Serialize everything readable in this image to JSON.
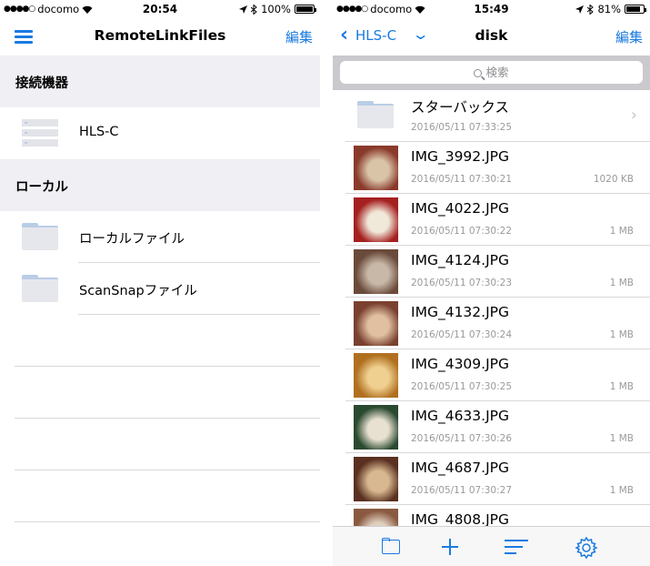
{
  "colors": {
    "accent": "#1a7ae0",
    "section_bg": "#efeff4",
    "secondary_text": "#9a9a9f"
  },
  "left": {
    "status": {
      "carrier": "docomo",
      "time": "20:54",
      "battery": "100%",
      "battery_level": 1.0
    },
    "nav": {
      "title": "RemoteLinkFiles",
      "edit_label": "編集",
      "menu_icon": "hamburger-menu-icon"
    },
    "sections": [
      {
        "title": "接続機器",
        "items": [
          {
            "label": "HLS-C",
            "icon": "server-icon"
          }
        ]
      },
      {
        "title": "ローカル",
        "items": [
          {
            "label": "ローカルファイル",
            "icon": "folder-icon"
          },
          {
            "label": "ScanSnapファイル",
            "icon": "folder-icon"
          }
        ]
      }
    ]
  },
  "right": {
    "status": {
      "carrier": "docomo",
      "time": "15:49",
      "battery": "81%",
      "battery_level": 0.81
    },
    "nav": {
      "back_label": "HLS-C",
      "title": "disk",
      "edit_label": "編集"
    },
    "search": {
      "placeholder": "検索"
    },
    "files": [
      {
        "name": "スターバックス",
        "date": "2016/05/11 07:33:25",
        "size": "",
        "type": "folder"
      },
      {
        "name": "IMG_3992.JPG",
        "date": "2016/05/11 07:30:21",
        "size": "1020 KB",
        "type": "image"
      },
      {
        "name": "IMG_4022.JPG",
        "date": "2016/05/11 07:30:22",
        "size": "1 MB",
        "type": "image"
      },
      {
        "name": "IMG_4124.JPG",
        "date": "2016/05/11 07:30:23",
        "size": "1 MB",
        "type": "image"
      },
      {
        "name": "IMG_4132.JPG",
        "date": "2016/05/11 07:30:24",
        "size": "1 MB",
        "type": "image"
      },
      {
        "name": "IMG_4309.JPG",
        "date": "2016/05/11 07:30:25",
        "size": "1 MB",
        "type": "image"
      },
      {
        "name": "IMG_4633.JPG",
        "date": "2016/05/11 07:30:26",
        "size": "1 MB",
        "type": "image"
      },
      {
        "name": "IMG_4687.JPG",
        "date": "2016/05/11 07:30:27",
        "size": "1 MB",
        "type": "image"
      },
      {
        "name": "IMG_4808.JPG",
        "date": "",
        "size": "",
        "type": "image"
      }
    ],
    "tabbar": [
      "folder-icon",
      "plus-icon",
      "sort-icon",
      "settings-gear-icon"
    ]
  }
}
